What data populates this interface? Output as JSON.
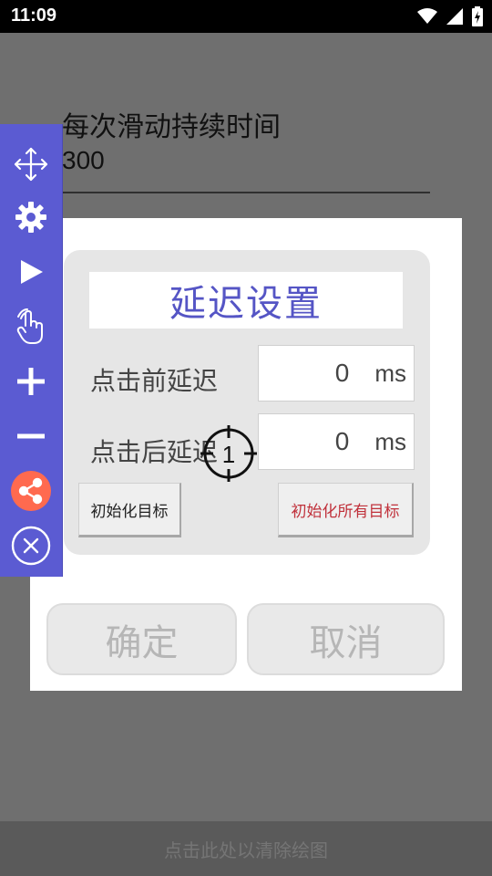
{
  "status_bar": {
    "time": "11:09",
    "icons": [
      "wifi-icon",
      "cell-signal-icon",
      "battery-charging-icon"
    ]
  },
  "background_setting": {
    "title": "每次滑动持续时间",
    "value": "300"
  },
  "toolbar": {
    "items": [
      {
        "icon": "move-arrows-icon"
      },
      {
        "icon": "gear-icon"
      },
      {
        "icon": "play-icon"
      },
      {
        "icon": "tap-gesture-icon"
      },
      {
        "icon": "plus-icon"
      },
      {
        "icon": "minus-icon"
      },
      {
        "icon": "share-icon"
      },
      {
        "icon": "close-circle-icon"
      }
    ]
  },
  "dialog": {
    "title": "延迟设置",
    "pre_click_label": "点击前延迟",
    "pre_click_value": "0",
    "post_click_label": "点击后延迟",
    "post_click_value": "0",
    "unit": "ms",
    "init_target_label": "初始化目标",
    "init_all_targets_label": "初始化所有目标",
    "ok_label": "确定",
    "cancel_label": "取消"
  },
  "crosshair": {
    "number": "1"
  },
  "bottom_bar": {
    "text": "点击此处以清除绘图"
  },
  "colors": {
    "toolbar_bg": "#5b5bd2",
    "title_accent": "#5555c5",
    "danger_text": "#c0313b",
    "share_button": "#ff6a4f"
  }
}
